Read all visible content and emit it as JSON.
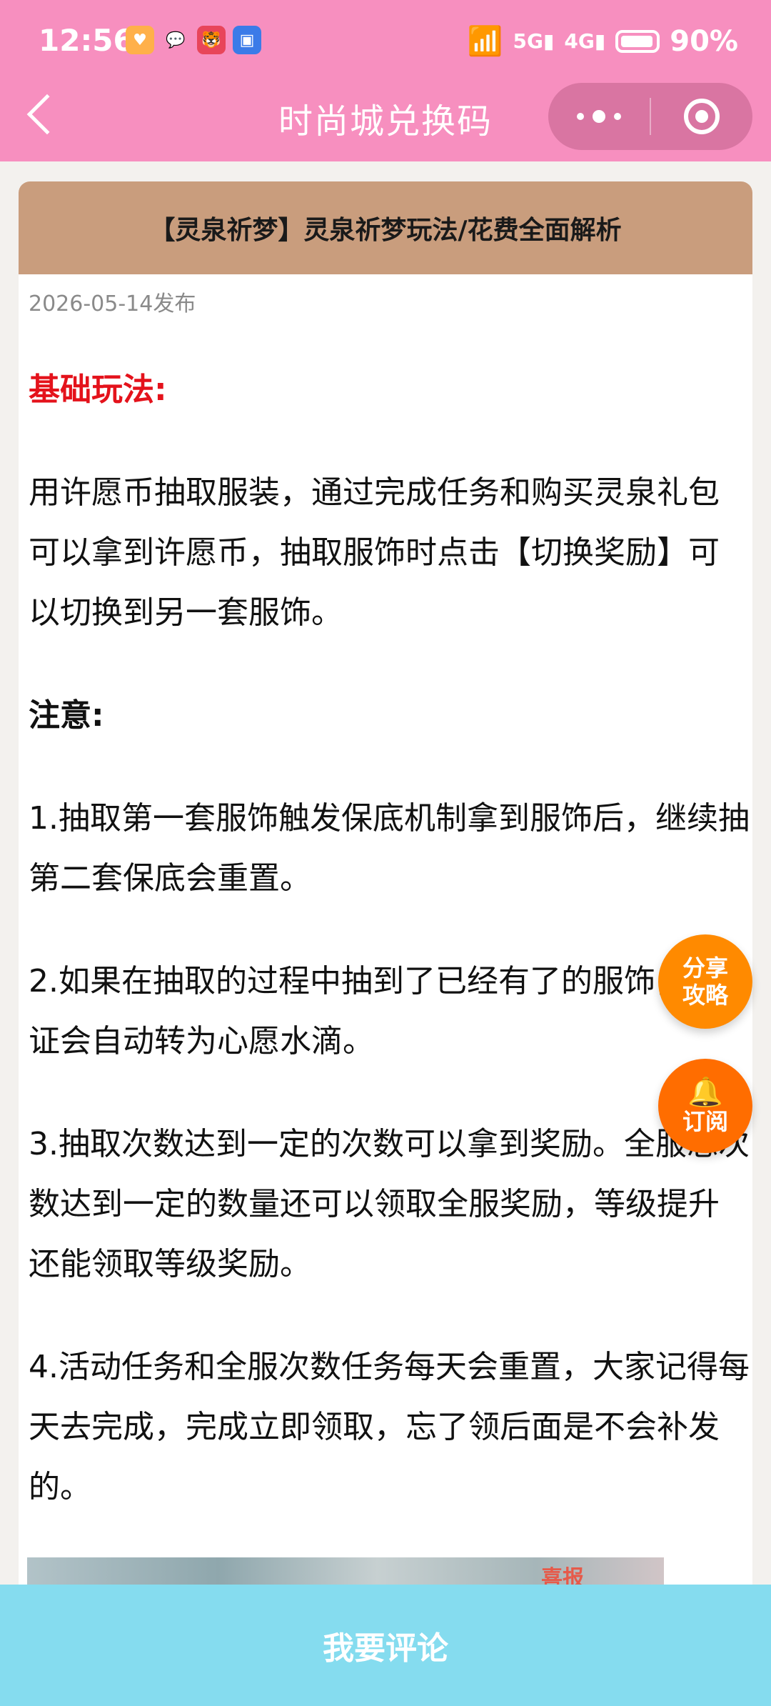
{
  "status_bar": {
    "time": "12:56",
    "battery": "90%",
    "app_icons": [
      "heart-app-icon",
      "chat-bubble-icon",
      "tiger-app-icon",
      "id-card-app-icon"
    ]
  },
  "nav": {
    "title": "时尚城兑换码"
  },
  "article": {
    "title": "【灵泉祈梦】灵泉祈梦玩法/花费全面解析",
    "date": "2026-05-14发布",
    "section_heading": "基础玩法:",
    "intro": "用许愿币抽取服装，通过完成任务和购买灵泉礼包可以拿到许愿币，抽取服饰时点击【切换奖励】可以切换到另一套服饰。",
    "note_heading": "注意:",
    "notes": [
      "1.抽取第一套服饰触发保底机制拿到服饰后，继续抽第二套保底会重置。",
      "2.如果在抽取的过程中抽到了已经有了的服饰，蜜友证会自动转为心愿水滴。",
      "3.抽取次数达到一定的次数可以拿到奖励。全服总次数达到一定的数量还可以领取全服奖励，等级提升还能领取等级奖励。",
      "4.活动任务和全服次数任务每天会重置，大家记得每天去完成，完成立即领取，忘了领后面是不会补发的。"
    ],
    "image_label": "喜报"
  },
  "floating": {
    "share_line1": "分享",
    "share_line2": "攻略",
    "subscribe": "订阅"
  },
  "bottom_bar": {
    "comment_label": "我要评论"
  }
}
